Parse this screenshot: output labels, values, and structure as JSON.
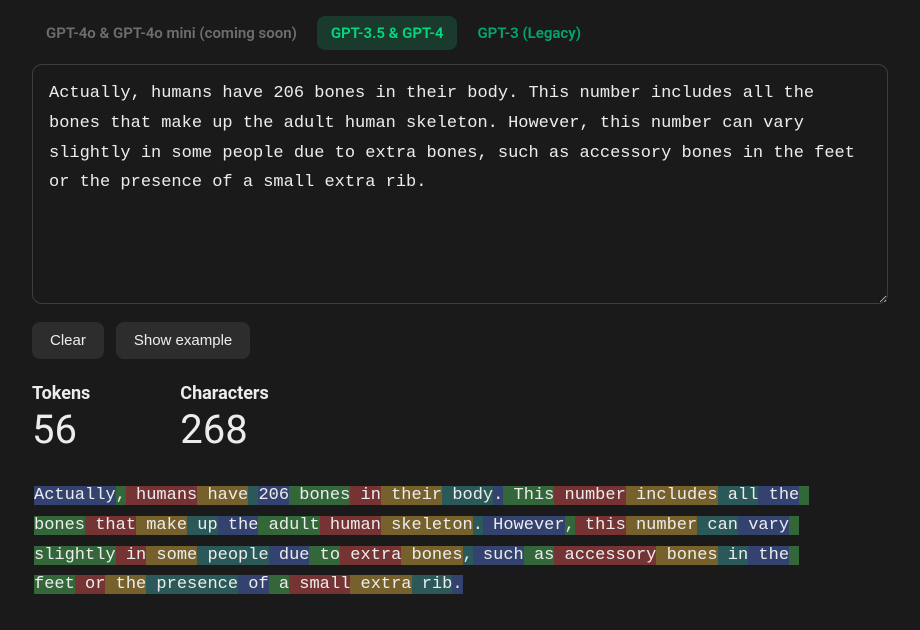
{
  "tabs": [
    {
      "label": "GPT-4o & GPT-4o mini (coming soon)",
      "state": "disabled"
    },
    {
      "label": "GPT-3.5 & GPT-4",
      "state": "active"
    },
    {
      "label": "GPT-3 (Legacy)",
      "state": "inactive"
    }
  ],
  "input_text": "Actually, humans have 206 bones in their body. This number includes all the bones that make up the adult human skeleton. However, this number can vary slightly in some people due to extra bones, such as accessory bones in the feet or the presence of a small extra rib.",
  "buttons": {
    "clear": "Clear",
    "show_example": "Show example"
  },
  "stats": {
    "tokens_label": "Tokens",
    "tokens_value": "56",
    "chars_label": "Characters",
    "chars_value": "268"
  },
  "tokens": [
    "Actually",
    ",",
    " humans",
    " have",
    " ",
    "206",
    " bones",
    " in",
    " their",
    " body",
    ".",
    " This",
    " number",
    " includes",
    " all",
    " the",
    " bones",
    " that",
    " make",
    " up",
    " the",
    " adult",
    " human",
    " skeleton",
    ".",
    " However",
    ",",
    " this",
    " number",
    " can",
    " vary",
    " slightly",
    " in",
    " some",
    " people",
    " due",
    " to",
    " extra",
    " bones",
    ",",
    " such",
    " as",
    " accessory",
    " bones",
    " in",
    " the",
    " feet",
    " or",
    " the",
    " presence",
    " of",
    " a",
    " small",
    " extra",
    " rib",
    "."
  ]
}
